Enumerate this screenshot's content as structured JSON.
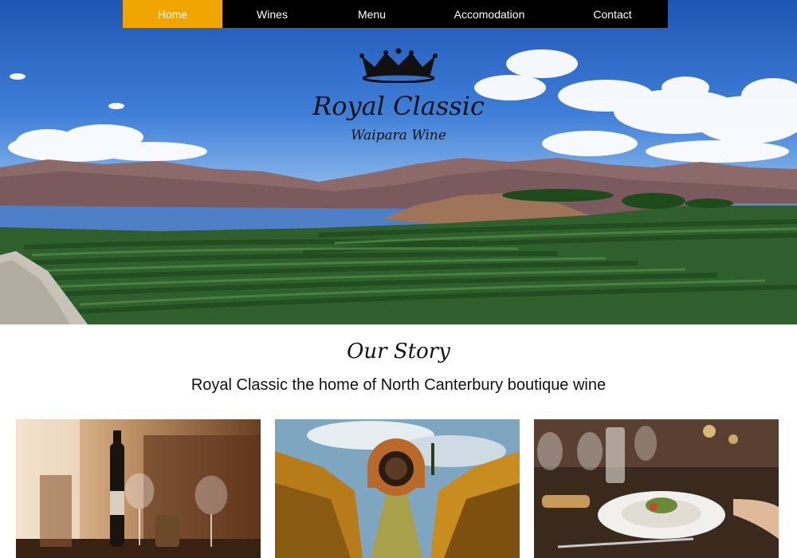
{
  "nav": {
    "items": [
      {
        "label": "Home",
        "active": true
      },
      {
        "label": "Wines",
        "active": false
      },
      {
        "label": "Menu",
        "active": false
      },
      {
        "label": "Accomodation",
        "active": false
      },
      {
        "label": "Contact",
        "active": false
      }
    ]
  },
  "brand": {
    "title": "Royal Classic",
    "subtitle": "Waipara Wine",
    "logo_icon": "crown-icon"
  },
  "story": {
    "title": "Our Story",
    "subtitle": "Royal Classic the home of North Canterbury boutique wine"
  },
  "colors": {
    "nav_bg": "#000000",
    "nav_active": "#f0a500",
    "nav_text": "#ffffff",
    "text_dark": "#111111"
  }
}
